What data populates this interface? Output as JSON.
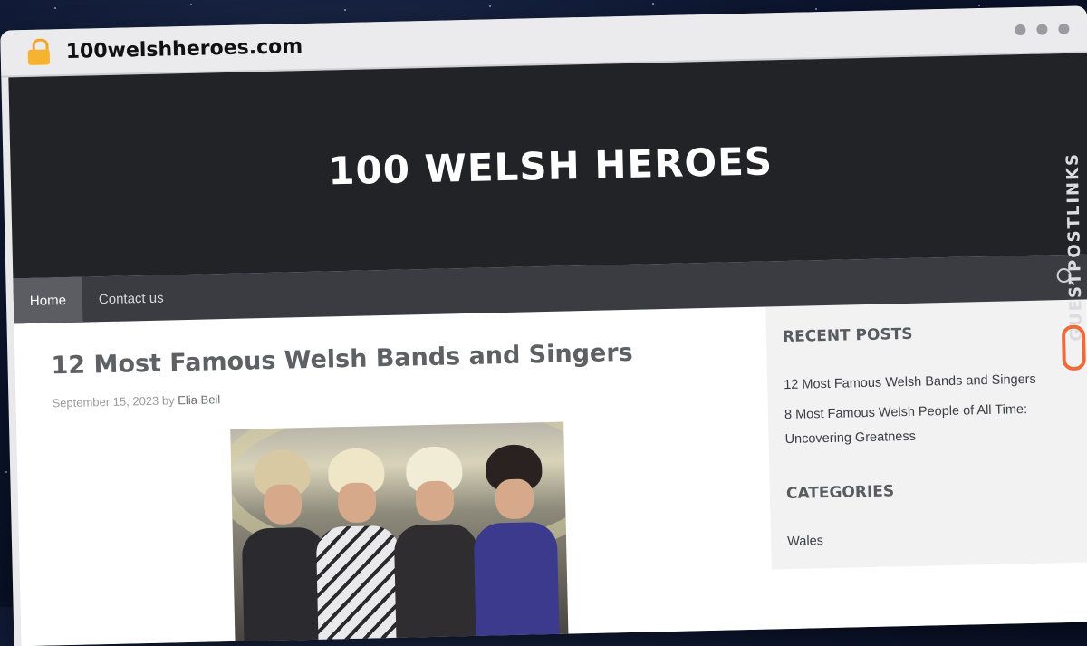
{
  "browser": {
    "url": "100welshheroes.com"
  },
  "site": {
    "title": "100 WELSH HEROES",
    "nav": [
      {
        "label": "Home",
        "active": true
      },
      {
        "label": "Contact us",
        "active": false
      }
    ]
  },
  "post": {
    "title": "12 Most Famous Welsh Bands and Singers",
    "date": "September 15, 2023",
    "by": "by",
    "author": "Elia Beil"
  },
  "sidebar": {
    "recent_title": "RECENT POSTS",
    "recent_posts": [
      "12 Most Famous Welsh Bands and Singers",
      "8 Most Famous Welsh People of All Time: Uncovering Greatness"
    ],
    "categories_title": "CATEGORIES",
    "categories": [
      "Wales"
    ]
  },
  "watermark": "GUESTPOSTLINKS",
  "colors": {
    "header_bg": "#222326",
    "nav_bg": "#3a3c41",
    "accent": "#ee6a3a"
  },
  "icons": [
    "lock-icon",
    "search-icon",
    "window-dot-icon",
    "link-chain-icon"
  ]
}
